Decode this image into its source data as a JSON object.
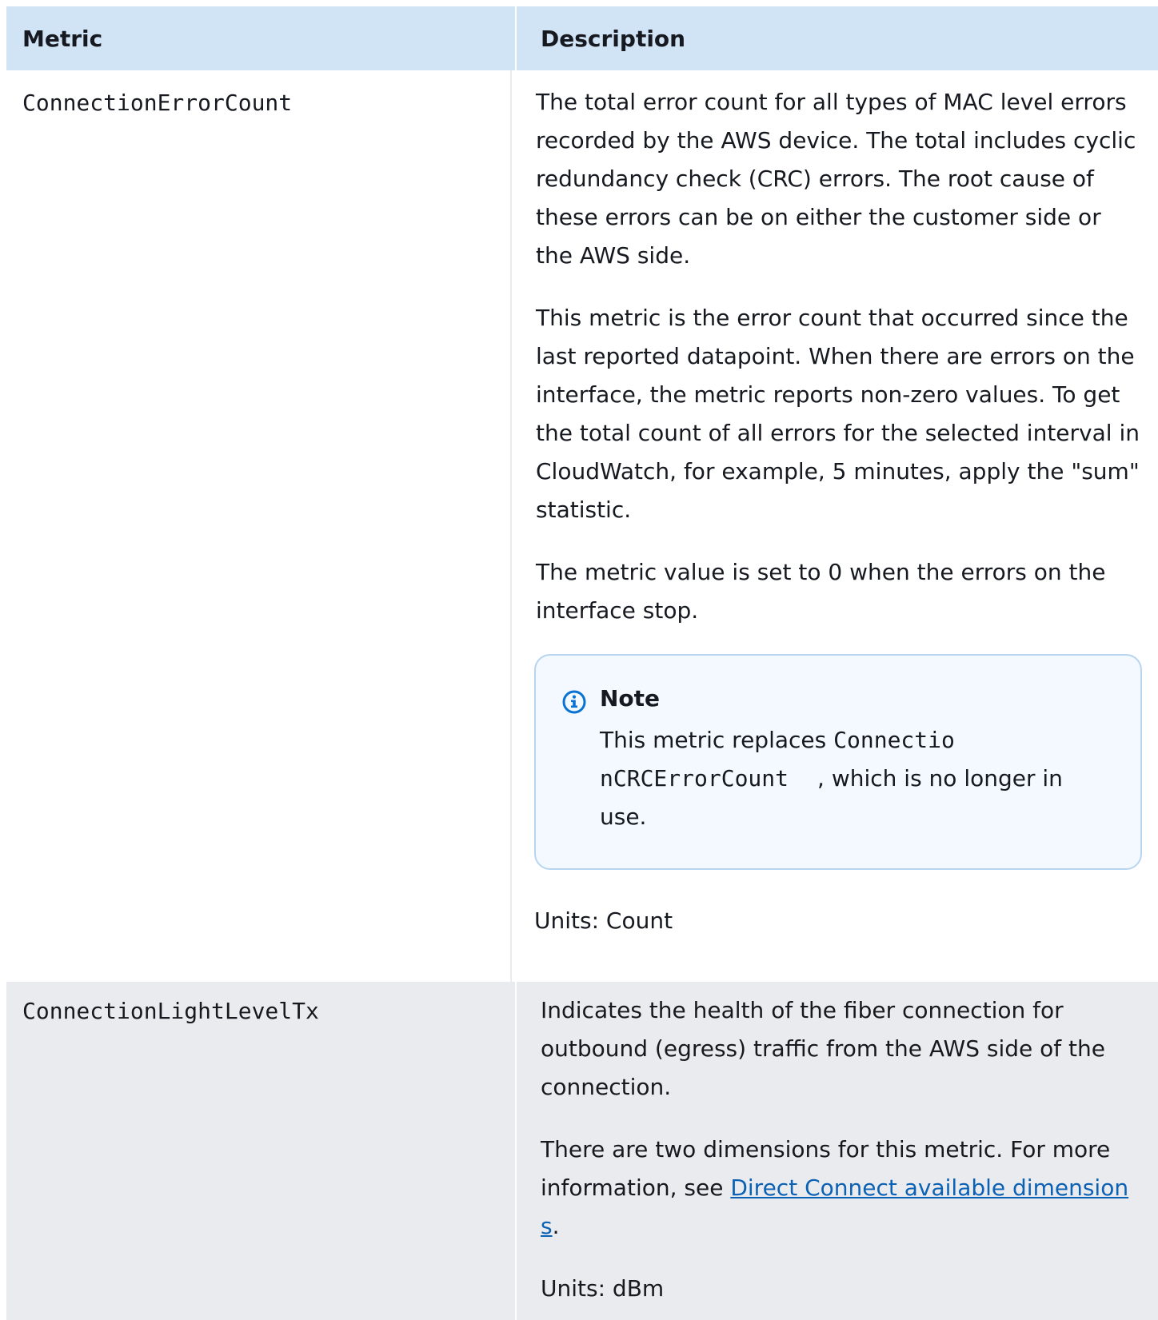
{
  "table": {
    "header": {
      "metric": "Metric",
      "description": "Description"
    },
    "rows": [
      {
        "metric": "ConnectionErrorCount",
        "paragraphs": [
          "The total error count for all types of MAC level errors recorded by the AWS device. The total includes cyclic redundancy check (CRC) errors. The root cause of these errors can be on either the customer side or the AWS side.",
          "This metric is the error count that occurred since the last reported datapoint. When there are errors on the interface, the metric reports non-zero values. To get the total count of all errors for the selected interval in CloudWatch, for example, 5 minutes, apply the \"sum\" statistic.",
          "The metric value is set to 0 when the errors on the interface stop."
        ],
        "note": {
          "icon": "info-icon",
          "title": "Note",
          "text_before": "This metric replaces ",
          "code_line1": "Connectio",
          "code_line2": "nCRCErrorCount",
          "text_after": ", which is no longer in use."
        },
        "units": "Units: Count"
      },
      {
        "metric": "ConnectionLightLevelTx",
        "paragraphs": [
          "Indicates the health of the fiber connection for outbound (egress) traffic from the AWS side of the connection."
        ],
        "dimension_text": "There are two dimensions for this metric. For more information, see ",
        "link_line1": "Direct Connect available dimension",
        "link_line2": "s",
        "dimension_end": ".",
        "units": "Units: dBm"
      }
    ]
  },
  "colors": {
    "header_bg": "#d1e4f6",
    "row_alt_bg": "#eaebee",
    "note_bg": "#f3f9fe",
    "note_border": "#b8d5ef",
    "link": "#0b62b5",
    "info_icon": "#0972d3"
  }
}
